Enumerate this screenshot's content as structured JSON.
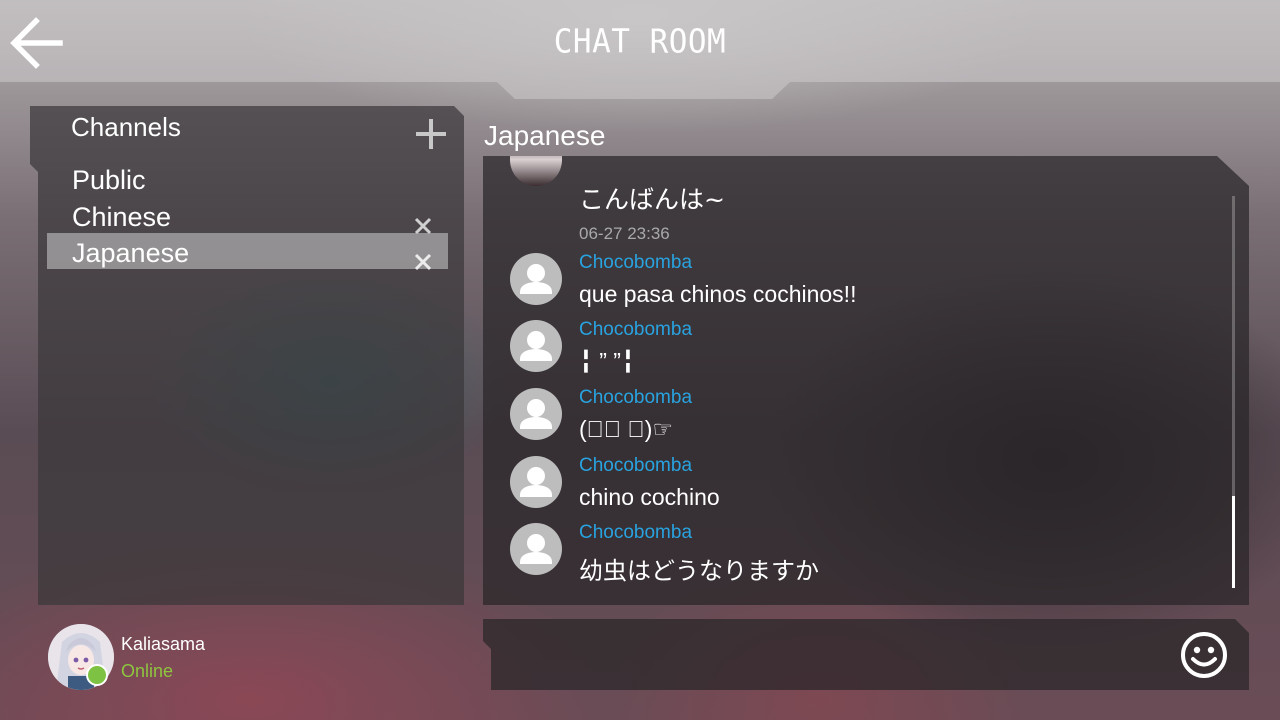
{
  "header": {
    "title": "CHAT ROOM",
    "back_icon": "arrow-left-icon"
  },
  "sidebar": {
    "heading": "Channels",
    "add_icon": "plus-icon",
    "channels": [
      {
        "label": "Public",
        "closable": false,
        "selected": false
      },
      {
        "label": "Chinese",
        "closable": true,
        "selected": false
      },
      {
        "label": "Japanese",
        "closable": true,
        "selected": true
      }
    ]
  },
  "chat": {
    "room_title": "Japanese",
    "first_message": {
      "text": "こんばんは~",
      "timestamp": "06-27 23:36"
    },
    "messages": [
      {
        "sender": "Chocobomba",
        "text": "que pasa chinos cochinos!!"
      },
      {
        "sender": "Chocobomba",
        "text": "╏ ” ”╏"
      },
      {
        "sender": "Chocobomba",
        "text": "(☞ﾟ ﾟ)☞"
      },
      {
        "sender": "Chocobomba",
        "text": "chino cochino"
      },
      {
        "sender": "Chocobomba",
        "text": "幼虫はどうなりますか"
      }
    ]
  },
  "composer": {
    "value": "",
    "emoji_icon": "smiley-icon"
  },
  "user": {
    "name": "Kaliasama",
    "status": "Online"
  },
  "colors": {
    "sender_name": "#29a3e0",
    "online": "#8dc63f",
    "selected_channel": "#cdcdcd"
  }
}
